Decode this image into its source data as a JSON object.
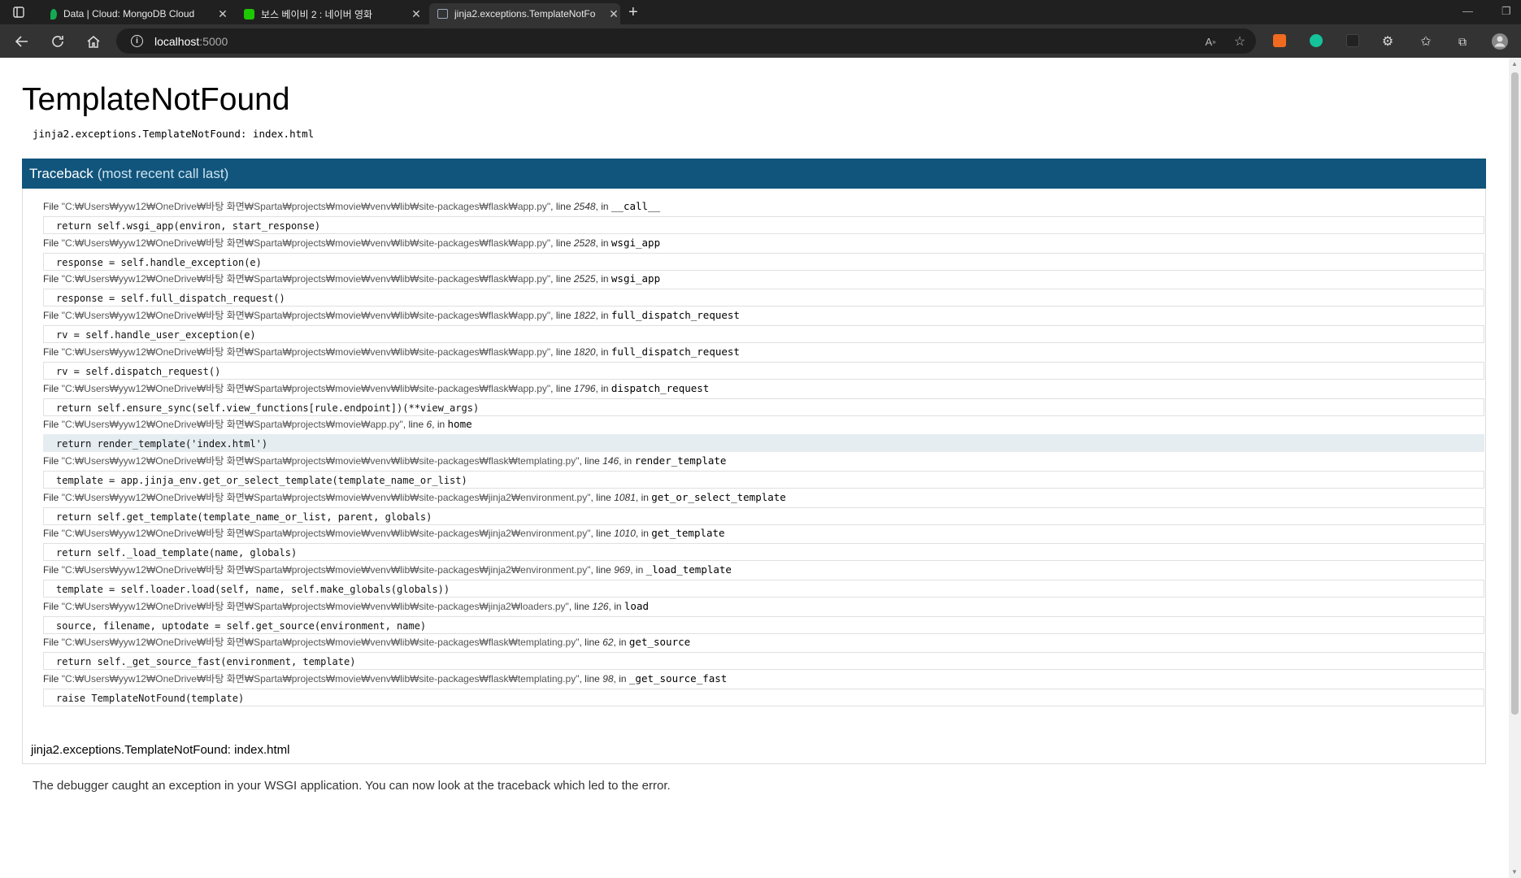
{
  "browser": {
    "tabs": [
      {
        "title": "Data | Cloud: MongoDB Cloud",
        "active": false
      },
      {
        "title": "보스 베이비 2 : 네이버 영화",
        "active": false
      },
      {
        "title": "jinja2.exceptions.TemplateNotFo",
        "active": true
      }
    ],
    "url_host": "localhost",
    "url_port": ":5000"
  },
  "page": {
    "title": "TemplateNotFound",
    "error_message": "jinja2.exceptions.TemplateNotFound: index.html",
    "traceback_label": "Traceback",
    "traceback_sub": "(most recent call last)",
    "frames": [
      {
        "file": "\"C:₩Users₩yyw12₩OneDrive₩바탕 화면₩Sparta₩projects₩movie₩venv₩lib₩site-packages₩flask₩app.py\"",
        "line": "2548",
        "func": "__call__",
        "code": "return self.wsgi_app(environ, start_response)",
        "current": false
      },
      {
        "file": "\"C:₩Users₩yyw12₩OneDrive₩바탕 화면₩Sparta₩projects₩movie₩venv₩lib₩site-packages₩flask₩app.py\"",
        "line": "2528",
        "func": "wsgi_app",
        "code": "response = self.handle_exception(e)",
        "current": false
      },
      {
        "file": "\"C:₩Users₩yyw12₩OneDrive₩바탕 화면₩Sparta₩projects₩movie₩venv₩lib₩site-packages₩flask₩app.py\"",
        "line": "2525",
        "func": "wsgi_app",
        "code": "response = self.full_dispatch_request()",
        "current": false
      },
      {
        "file": "\"C:₩Users₩yyw12₩OneDrive₩바탕 화면₩Sparta₩projects₩movie₩venv₩lib₩site-packages₩flask₩app.py\"",
        "line": "1822",
        "func": "full_dispatch_request",
        "code": "rv = self.handle_user_exception(e)",
        "current": false
      },
      {
        "file": "\"C:₩Users₩yyw12₩OneDrive₩바탕 화면₩Sparta₩projects₩movie₩venv₩lib₩site-packages₩flask₩app.py\"",
        "line": "1820",
        "func": "full_dispatch_request",
        "code": "rv = self.dispatch_request()",
        "current": false
      },
      {
        "file": "\"C:₩Users₩yyw12₩OneDrive₩바탕 화면₩Sparta₩projects₩movie₩venv₩lib₩site-packages₩flask₩app.py\"",
        "line": "1796",
        "func": "dispatch_request",
        "code": "return self.ensure_sync(self.view_functions[rule.endpoint])(**view_args)",
        "current": false
      },
      {
        "file": "\"C:₩Users₩yyw12₩OneDrive₩바탕 화면₩Sparta₩projects₩movie₩app.py\"",
        "line": "6",
        "func": "home",
        "code": "return render_template('index.html')",
        "current": true
      },
      {
        "file": "\"C:₩Users₩yyw12₩OneDrive₩바탕 화면₩Sparta₩projects₩movie₩venv₩lib₩site-packages₩flask₩templating.py\"",
        "line": "146",
        "func": "render_template",
        "code": "template = app.jinja_env.get_or_select_template(template_name_or_list)",
        "current": false
      },
      {
        "file": "\"C:₩Users₩yyw12₩OneDrive₩바탕 화면₩Sparta₩projects₩movie₩venv₩lib₩site-packages₩jinja2₩environment.py\"",
        "line": "1081",
        "func": "get_or_select_template",
        "code": "return self.get_template(template_name_or_list, parent, globals)",
        "current": false
      },
      {
        "file": "\"C:₩Users₩yyw12₩OneDrive₩바탕 화면₩Sparta₩projects₩movie₩venv₩lib₩site-packages₩jinja2₩environment.py\"",
        "line": "1010",
        "func": "get_template",
        "code": "return self._load_template(name, globals)",
        "current": false
      },
      {
        "file": "\"C:₩Users₩yyw12₩OneDrive₩바탕 화면₩Sparta₩projects₩movie₩venv₩lib₩site-packages₩jinja2₩environment.py\"",
        "line": "969",
        "func": "_load_template",
        "code": "template = self.loader.load(self, name, self.make_globals(globals))",
        "current": false
      },
      {
        "file": "\"C:₩Users₩yyw12₩OneDrive₩바탕 화면₩Sparta₩projects₩movie₩venv₩lib₩site-packages₩jinja2₩loaders.py\"",
        "line": "126",
        "func": "load",
        "code": "source, filename, uptodate = self.get_source(environment, name)",
        "current": false
      },
      {
        "file": "\"C:₩Users₩yyw12₩OneDrive₩바탕 화면₩Sparta₩projects₩movie₩venv₩lib₩site-packages₩flask₩templating.py\"",
        "line": "62",
        "func": "get_source",
        "code": "return self._get_source_fast(environment, template)",
        "current": false
      },
      {
        "file": "\"C:₩Users₩yyw12₩OneDrive₩바탕 화면₩Sparta₩projects₩movie₩venv₩lib₩site-packages₩flask₩templating.py\"",
        "line": "98",
        "func": "_get_source_fast",
        "code": "raise TemplateNotFound(template)",
        "current": false
      }
    ],
    "plain_error": "jinja2.exceptions.TemplateNotFound: index.html",
    "explanation": "The debugger caught an exception in your WSGI application. You can now look at the traceback which led to the error.",
    "file_word": "File",
    "line_word": "line",
    "in_word": "in"
  },
  "colors": {
    "traceback_header": "#11557c",
    "current_line_bg": "#e6edf0"
  }
}
